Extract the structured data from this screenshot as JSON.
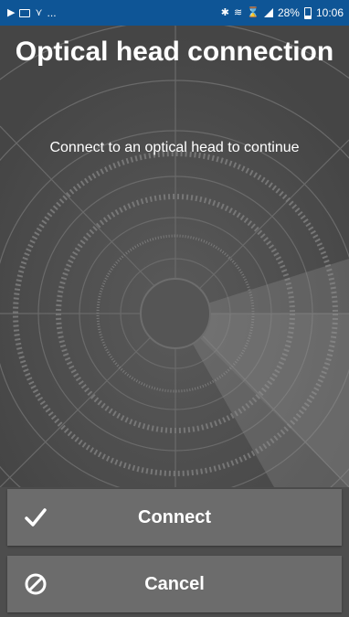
{
  "status_bar": {
    "left_icons": [
      "play-icon",
      "image-icon",
      "wifi-alert-icon"
    ],
    "left_more": "...",
    "right_icons": [
      "bluetooth-icon",
      "vibrate-icon",
      "alarm-icon",
      "signal-icon"
    ],
    "battery": "28%",
    "time": "10:06",
    "background_color": "#0e5596"
  },
  "header": {
    "title": "Optical head connection",
    "subtitle": "Connect to an optical head to continue"
  },
  "buttons": {
    "connect": {
      "label": "Connect",
      "icon": "checkmark-icon"
    },
    "cancel": {
      "label": "Cancel",
      "icon": "cancel-icon"
    }
  }
}
